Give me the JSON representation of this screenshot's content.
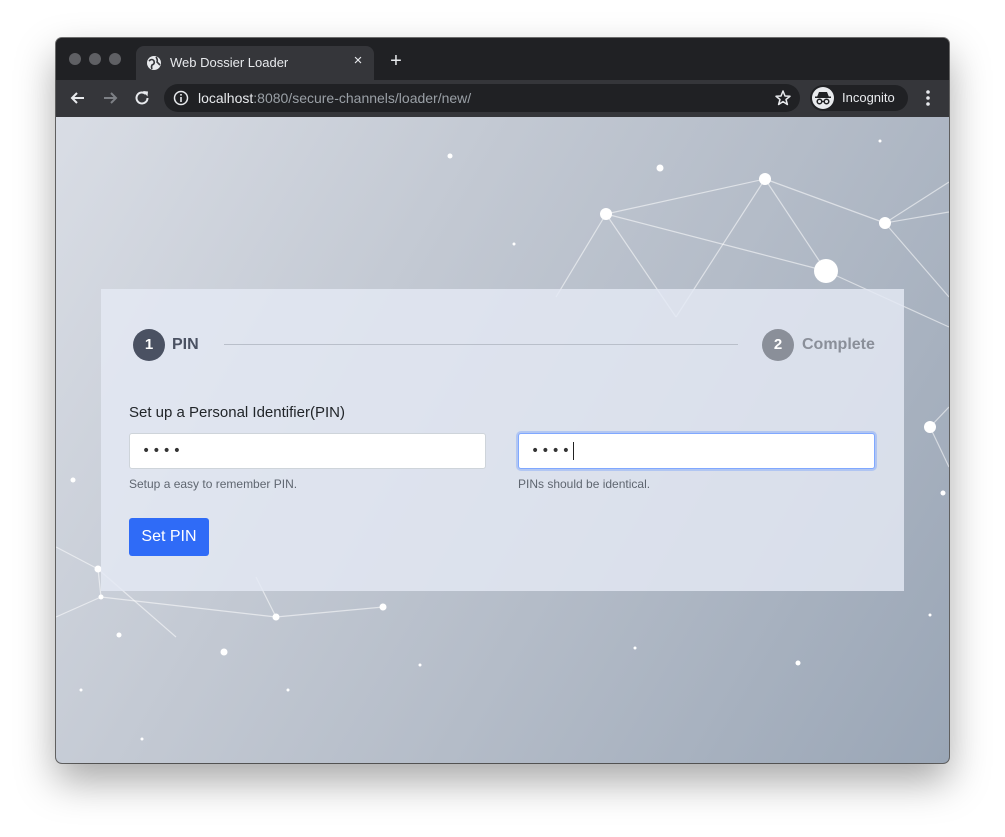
{
  "browser": {
    "tab_title": "Web Dossier Loader",
    "tab_close": "×",
    "new_tab": "+",
    "url_host": "localhost",
    "url_rest": ":8080/secure-channels/loader/new/",
    "incognito_label": "Incognito"
  },
  "wizard": {
    "steps": [
      {
        "number": "1",
        "label": "PIN",
        "state": "active"
      },
      {
        "number": "2",
        "label": "Complete",
        "state": "inactive"
      }
    ],
    "section_label": "Set up a Personal Identifier(PIN)",
    "pin_field": {
      "value": "••••",
      "help": "Setup a easy to remember PIN."
    },
    "confirm_field": {
      "value": "••••",
      "help": "PINs should be identical."
    },
    "submit_label": "Set PIN"
  },
  "colors": {
    "accent": "#2f6bf7",
    "step_active": "#4a5162",
    "step_inactive": "#8a8f99"
  }
}
